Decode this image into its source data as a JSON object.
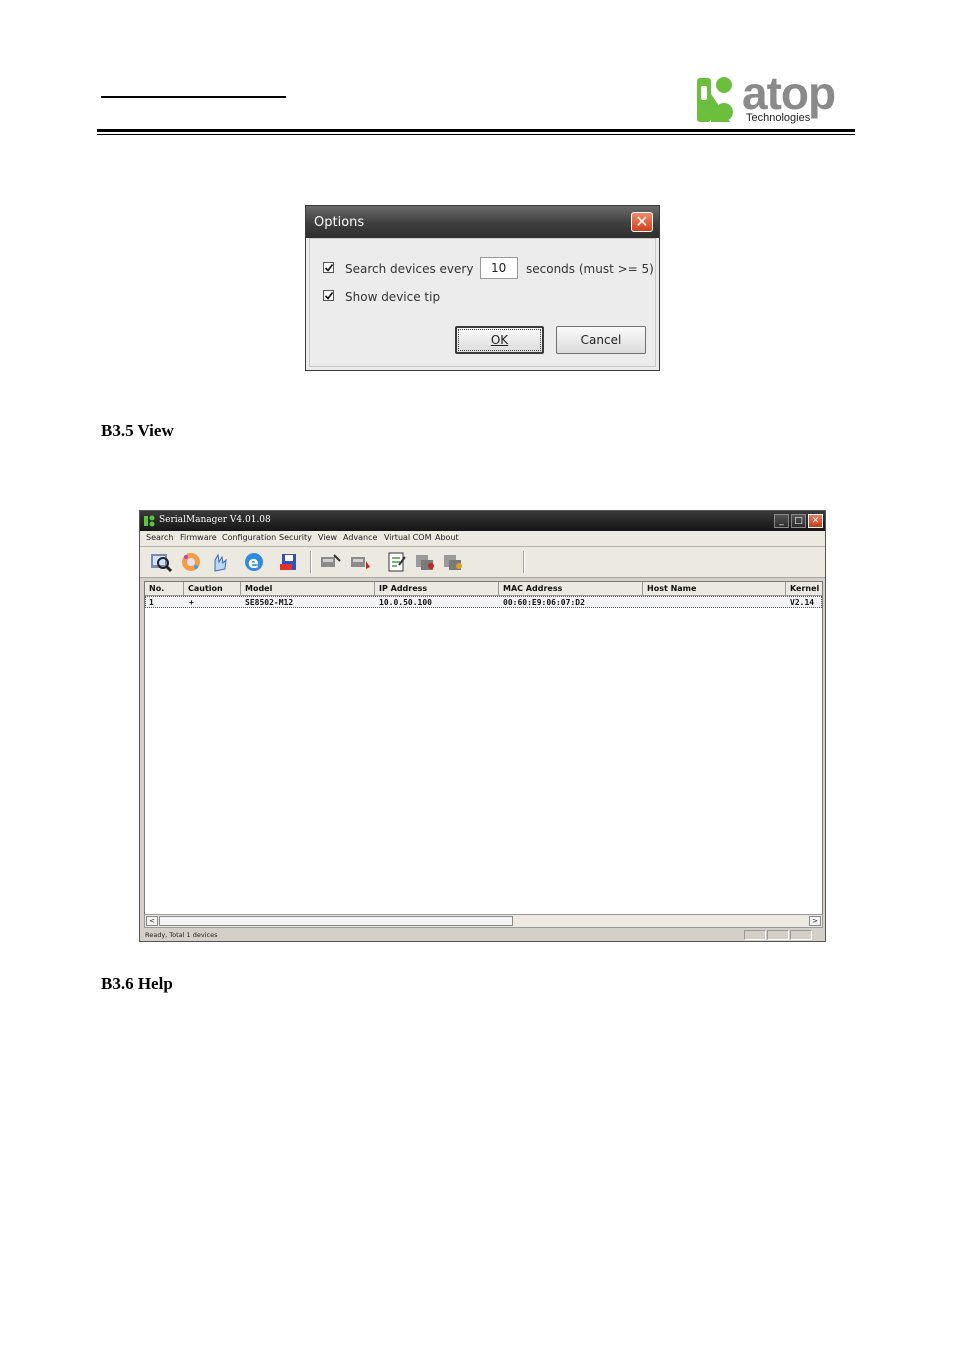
{
  "logo": {
    "name": "atop",
    "subtitle": "Technologies"
  },
  "sections": {
    "view": "B3.5 View",
    "help": "B3.6 Help"
  },
  "options_dialog": {
    "title": "Options",
    "search_label": "Search devices every",
    "search_checked": true,
    "interval_value": "10",
    "interval_suffix": "seconds (must >= 5)",
    "tip_label": "Show device tip",
    "tip_checked": true,
    "ok_label": "OK",
    "cancel_label": "Cancel"
  },
  "serial_manager": {
    "title": "SerialManager V4.01.08",
    "menu": [
      "Search",
      "Firmware",
      "Configuration",
      "Security",
      "View",
      "Advance",
      "Virtual COM",
      "About"
    ],
    "columns": [
      "No.",
      "Caution",
      "Model",
      "IP Address",
      "MAC Address",
      "Host Name",
      "Kernel"
    ],
    "rows": [
      {
        "no": "1",
        "caution": "+",
        "model": "SE8502-M12",
        "ip": "10.0.50.100",
        "mac": "00:60:E9:06:07:D2",
        "host": "",
        "kernel": "V2.14"
      }
    ],
    "status_text": "Ready, Total 1 devices"
  }
}
